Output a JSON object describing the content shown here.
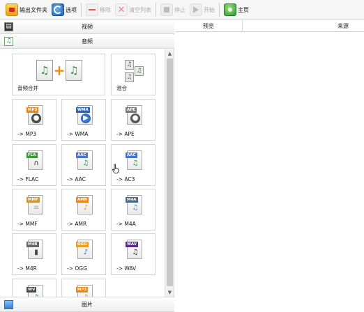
{
  "toolbar": {
    "output_folder": "输出文件夹",
    "options": "选项",
    "remove": "移除",
    "clear_list": "清空列表",
    "stop": "停止",
    "start": "开始",
    "home": "主页"
  },
  "categories": {
    "video": "视频",
    "audio": "音频",
    "image": "图片"
  },
  "tiles": {
    "audio_merge": "音频合并",
    "mix": "混合",
    "mp3": {
      "label": "-> MP3",
      "badge": "MP3",
      "color": "#e88a1a"
    },
    "wma": {
      "label": "-> WMA",
      "badge": "WMA",
      "color": "#2a62b8"
    },
    "ape": {
      "label": "-> APE",
      "badge": "APE",
      "color": "#7a7a7a"
    },
    "flac": {
      "label": "-> FLAC",
      "badge": "FLA",
      "color": "#3a9a3a"
    },
    "aac": {
      "label": "-> AAC",
      "badge": "AAC",
      "color": "#4a74c8"
    },
    "ac3": {
      "label": "-> AC3",
      "badge": "AAC",
      "color": "#4a74c8"
    },
    "mmf": {
      "label": "-> MMF",
      "badge": "MMF",
      "color": "#c89a3a"
    },
    "amr": {
      "label": "-> AMR",
      "badge": "AMR",
      "color": "#e88a1a"
    },
    "m4a": {
      "label": "-> M4A",
      "badge": "M4A",
      "color": "#4a6a8a"
    },
    "m4r": {
      "label": "-> M4R",
      "badge": "M4R",
      "color": "#666666"
    },
    "ogg": {
      "label": "-> OGG",
      "badge": "OGG",
      "color": "#f0a020"
    },
    "wav": {
      "label": "-> WAV",
      "badge": "WAV",
      "color": "#5a2a8a"
    },
    "wv": {
      "badge": "WV",
      "color": "#4a4a4a"
    },
    "mp2": {
      "badge": "MP2",
      "color": "#e88a1a"
    }
  },
  "file_list": {
    "col_preview": "预览",
    "col_source": "来源"
  }
}
